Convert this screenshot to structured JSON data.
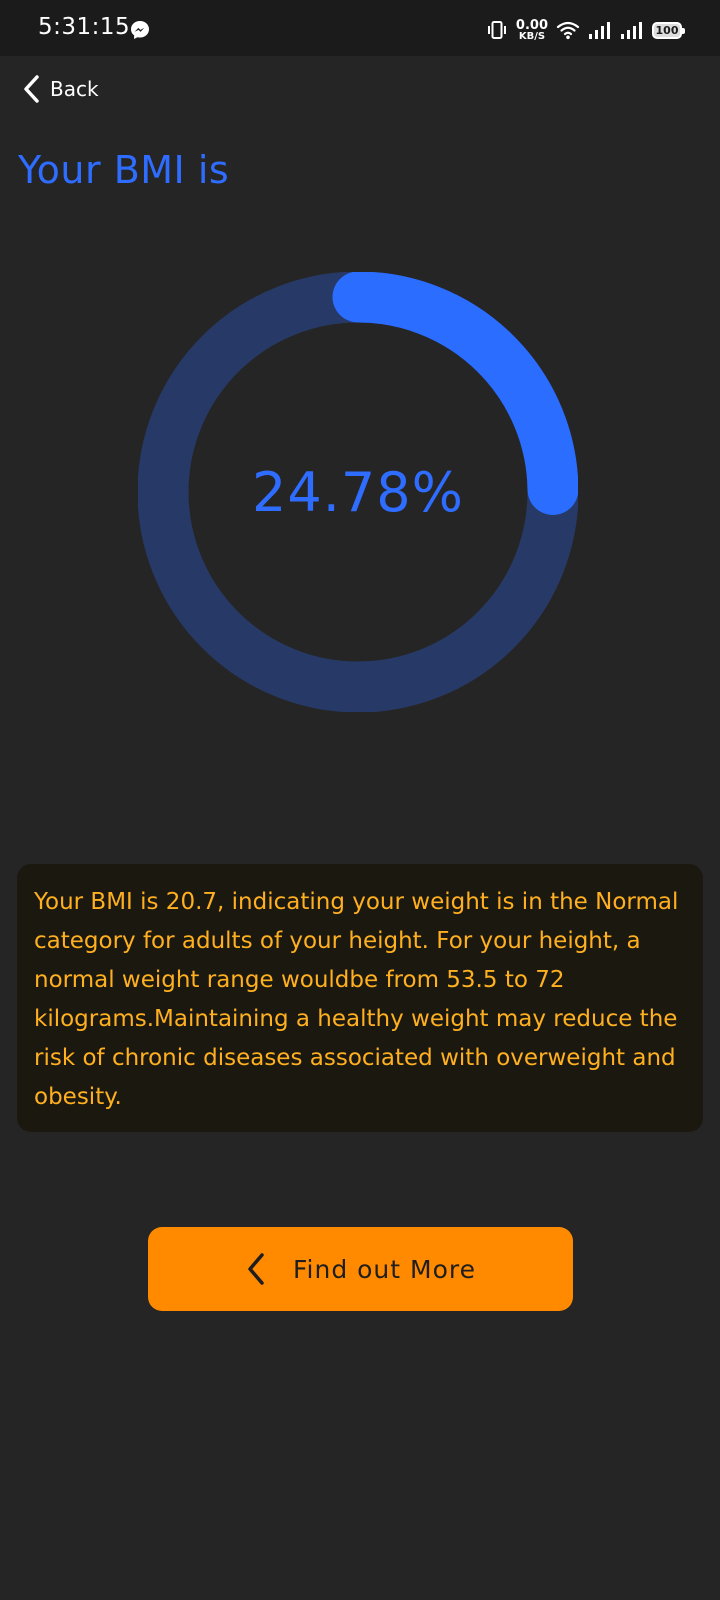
{
  "status_bar": {
    "time": "5:31:15",
    "net_speed_value": "0.00",
    "net_speed_unit": "KB/S",
    "battery": "100"
  },
  "nav": {
    "back_label": "Back"
  },
  "title": "Your BMI is",
  "gauge": {
    "value_text": "24.78%",
    "progress_percent": 24.78,
    "track_color": "#273a67",
    "fill_color": "#2a6dff"
  },
  "info": {
    "text": "Your BMI is 20.7, indicating your weight is in the Normal category for adults of your height.  For your height, a normal weight range wouldbe from 53.5 to 72 kilograms.Maintaining a healthy weight may reduce the risk of chronic diseases associated with overweight and obesity."
  },
  "actions": {
    "find_more_label": "Find out More"
  },
  "colors": {
    "background": "#252525",
    "accent_blue": "#2e6dff",
    "accent_orange": "#ff8a00",
    "info_text": "#ffb020"
  }
}
